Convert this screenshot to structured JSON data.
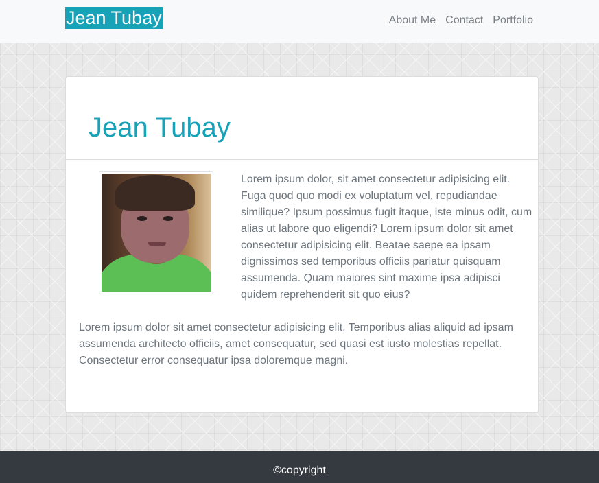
{
  "navbar": {
    "brand": "Jean Tubay",
    "links": [
      "About Me",
      "Contact",
      "Portfolio"
    ]
  },
  "card": {
    "title": "Jean Tubay",
    "paragraph1": "Lorem ipsum dolor, sit amet consectetur adipisicing elit. Fuga quod quo modi ex voluptatum vel, repudiandae similique? Ipsum possimus fugit itaque, iste minus odit, cum alias ut labore quo eligendi? Lorem ipsum dolor sit amet consectetur adipisicing elit. Beatae saepe ea ipsam dignissimos sed temporibus officiis pariatur quisquam assumenda. Quam maiores sint maxime ipsa adipisci quidem reprehenderit sit quo eius?",
    "paragraph2": "Lorem ipsum dolor sit amet consectetur adipisicing elit. Temporibus alias aliquid ad ipsam assumenda architecto officiis, amet consequatur, sed quasi est iusto molestias repellat. Consectetur error consequatur ipsa doloremque magni."
  },
  "footer": {
    "copyright": "©copyright"
  },
  "colors": {
    "accent": "#17a2b8",
    "footer_bg": "#343a40",
    "navbar_bg": "#f8f9fa",
    "text_muted": "#6c757d"
  }
}
